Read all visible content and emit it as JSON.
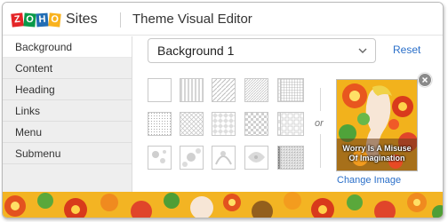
{
  "header": {
    "logo_letters": [
      "Z",
      "O",
      "H",
      "O"
    ],
    "logo_colors": [
      "#e42527",
      "#089949",
      "#226db4",
      "#f9b21d"
    ],
    "product": "Sites",
    "title": "Theme Visual Editor"
  },
  "sidebar": {
    "items": [
      {
        "label": "Background",
        "active": true
      },
      {
        "label": "Content",
        "active": false
      },
      {
        "label": "Heading",
        "active": false
      },
      {
        "label": "Links",
        "active": false
      },
      {
        "label": "Menu",
        "active": false
      },
      {
        "label": "Submenu",
        "active": false
      }
    ]
  },
  "background_select": {
    "value": "Background 1"
  },
  "reset_label": "Reset",
  "patterns": {
    "rows": [
      [
        "blank",
        "vertical-stripes",
        "diagonal-lines",
        "diagonal-fine",
        "grid",
        "dense-grid"
      ],
      [
        "dots",
        "cross-hatch",
        "diamond-check",
        "checkerboard",
        "large-check",
        "tiles"
      ],
      [
        "floral-1",
        "floral-2",
        "floral-3",
        "floral-4",
        "noise-dark",
        "noise-light"
      ]
    ]
  },
  "or_label": "or",
  "preview": {
    "caption_line1": "Worry Is A Misuse",
    "caption_line2": "Of Imagination"
  },
  "change_image_label": "Change Image",
  "colors": {
    "link": "#2a6fc9",
    "sidebar_bg": "#eeeeee"
  }
}
